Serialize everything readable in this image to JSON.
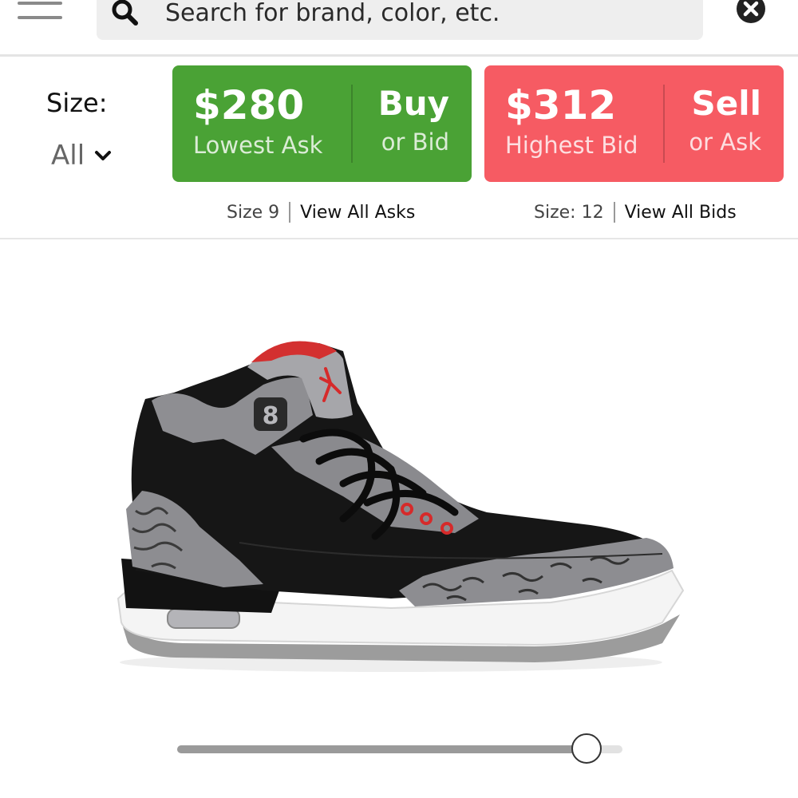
{
  "search": {
    "placeholder": "Search for brand, color, etc."
  },
  "size_selector": {
    "label": "Size:",
    "value": "All"
  },
  "ask_panel": {
    "price": "$280",
    "price_label": "Lowest Ask",
    "action": "Buy",
    "action_sub": "or Bid",
    "size_text": "Size 9",
    "link_text": "View All Asks",
    "color": "#4aa235"
  },
  "bid_panel": {
    "price": "$312",
    "price_label": "Highest Bid",
    "action": "Sell",
    "action_sub": "or Ask",
    "size_text": "Size: 12",
    "link_text": "View All Bids",
    "color": "#f65b63"
  },
  "product_image": {
    "icon": "sneaker-image",
    "colors": {
      "upper": "#161616",
      "cement": "#9b9b9e",
      "accent": "#d92b2b",
      "sole": "#f4f4f4"
    }
  },
  "viewer_slider": {
    "value": 0.92
  }
}
